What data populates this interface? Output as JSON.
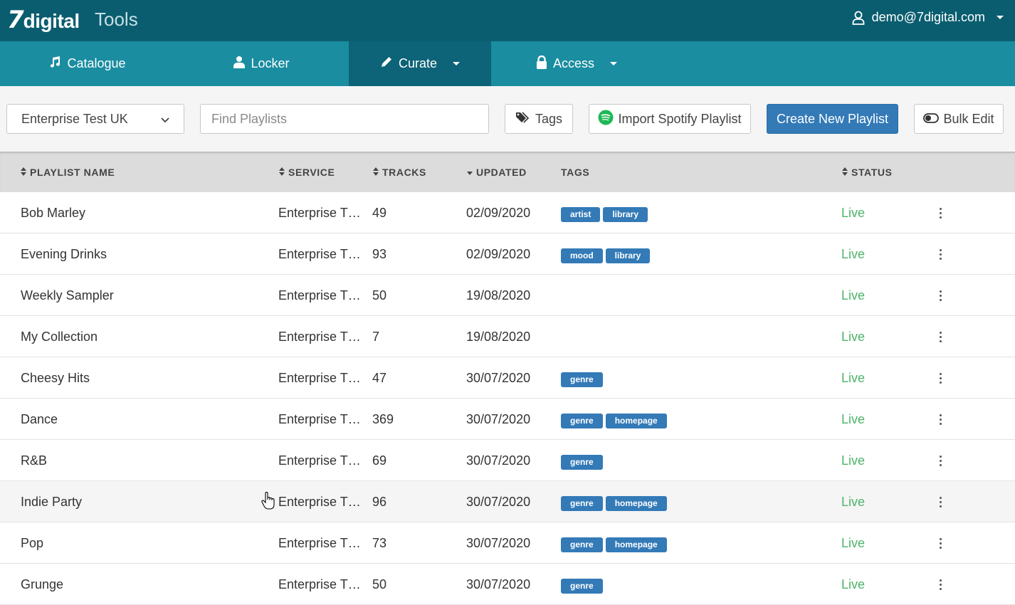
{
  "header": {
    "logo_seven": "7",
    "logo_word": "digital",
    "app_name": "Tools",
    "user_email": "demo@7digital.com"
  },
  "nav": {
    "catalogue": "Catalogue",
    "locker": "Locker",
    "curate": "Curate",
    "access": "Access",
    "active": "Curate"
  },
  "toolbar": {
    "service_select": "Enterprise Test UK",
    "search_placeholder": "Find Playlists",
    "tags_label": "Tags",
    "import_label": "Import Spotify Playlist",
    "create_label": "Create New Playlist",
    "bulk_label": "Bulk Edit"
  },
  "table": {
    "columns": {
      "name": "PLAYLIST NAME",
      "service": "SERVICE",
      "tracks": "TRACKS",
      "updated": "UPDATED",
      "tags": "TAGS",
      "status": "STATUS"
    },
    "rows": [
      {
        "name": "Bob Marley",
        "service": "Enterprise T…",
        "tracks": "49",
        "updated": "02/09/2020",
        "tags": [
          "artist",
          "library"
        ],
        "status": "Live"
      },
      {
        "name": "Evening Drinks",
        "service": "Enterprise T…",
        "tracks": "93",
        "updated": "02/09/2020",
        "tags": [
          "mood",
          "library"
        ],
        "status": "Live"
      },
      {
        "name": "Weekly Sampler",
        "service": "Enterprise T…",
        "tracks": "50",
        "updated": "19/08/2020",
        "tags": [],
        "status": "Live"
      },
      {
        "name": "My Collection",
        "service": "Enterprise T…",
        "tracks": "7",
        "updated": "19/08/2020",
        "tags": [],
        "status": "Live"
      },
      {
        "name": "Cheesy Hits",
        "service": "Enterprise T…",
        "tracks": "47",
        "updated": "30/07/2020",
        "tags": [
          "genre"
        ],
        "status": "Live"
      },
      {
        "name": "Dance",
        "service": "Enterprise T…",
        "tracks": "369",
        "updated": "30/07/2020",
        "tags": [
          "genre",
          "homepage"
        ],
        "status": "Live"
      },
      {
        "name": "R&B",
        "service": "Enterprise T…",
        "tracks": "69",
        "updated": "30/07/2020",
        "tags": [
          "genre"
        ],
        "status": "Live"
      },
      {
        "name": "Indie Party",
        "service": "Enterprise T…",
        "tracks": "96",
        "updated": "30/07/2020",
        "tags": [
          "genre",
          "homepage"
        ],
        "status": "Live"
      },
      {
        "name": "Pop",
        "service": "Enterprise T…",
        "tracks": "73",
        "updated": "30/07/2020",
        "tags": [
          "genre",
          "homepage"
        ],
        "status": "Live"
      },
      {
        "name": "Grunge",
        "service": "Enterprise T…",
        "tracks": "50",
        "updated": "30/07/2020",
        "tags": [
          "genre"
        ],
        "status": "Live"
      }
    ]
  },
  "colors": {
    "topbar": "#0a5d6f",
    "nav": "#1a8da0",
    "nav_active": "#0d6377",
    "primary": "#337ab7",
    "live": "#4db36a",
    "spotify": "#1db954"
  },
  "icons": {
    "user": "user-icon",
    "catalogue": "music-note-icon",
    "locker": "person-icon",
    "curate": "pencil-icon",
    "access": "lock-icon",
    "tags": "tags-icon",
    "import": "spotify-icon",
    "bulk": "toggle-icon",
    "row_menu": "kebab-menu-icon"
  }
}
